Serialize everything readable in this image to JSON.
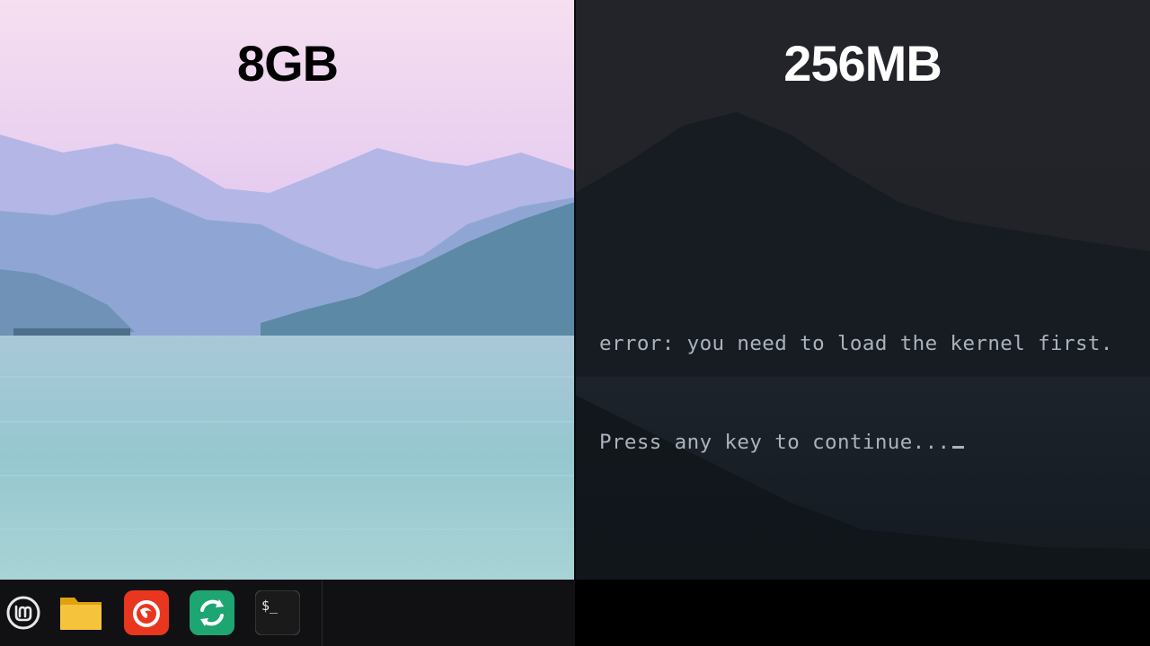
{
  "left_panel": {
    "caption": "8GB"
  },
  "right_panel": {
    "caption": "256MB",
    "console_lines": [
      "error: you need to load the kernel first.",
      "Press any key to continue..."
    ]
  },
  "taskbar": {
    "items": [
      {
        "icon": "mint-menu-icon"
      },
      {
        "icon": "folder-icon"
      },
      {
        "icon": "firefox-icon"
      },
      {
        "icon": "sync-app-icon"
      },
      {
        "icon": "terminal-icon",
        "glyph": "$_"
      }
    ]
  },
  "colors": {
    "left_sky_top": "#f2d6ee",
    "left_water": "#8fc4cc",
    "right_background": "#1b1e24",
    "console_text": "#aab3bd"
  }
}
